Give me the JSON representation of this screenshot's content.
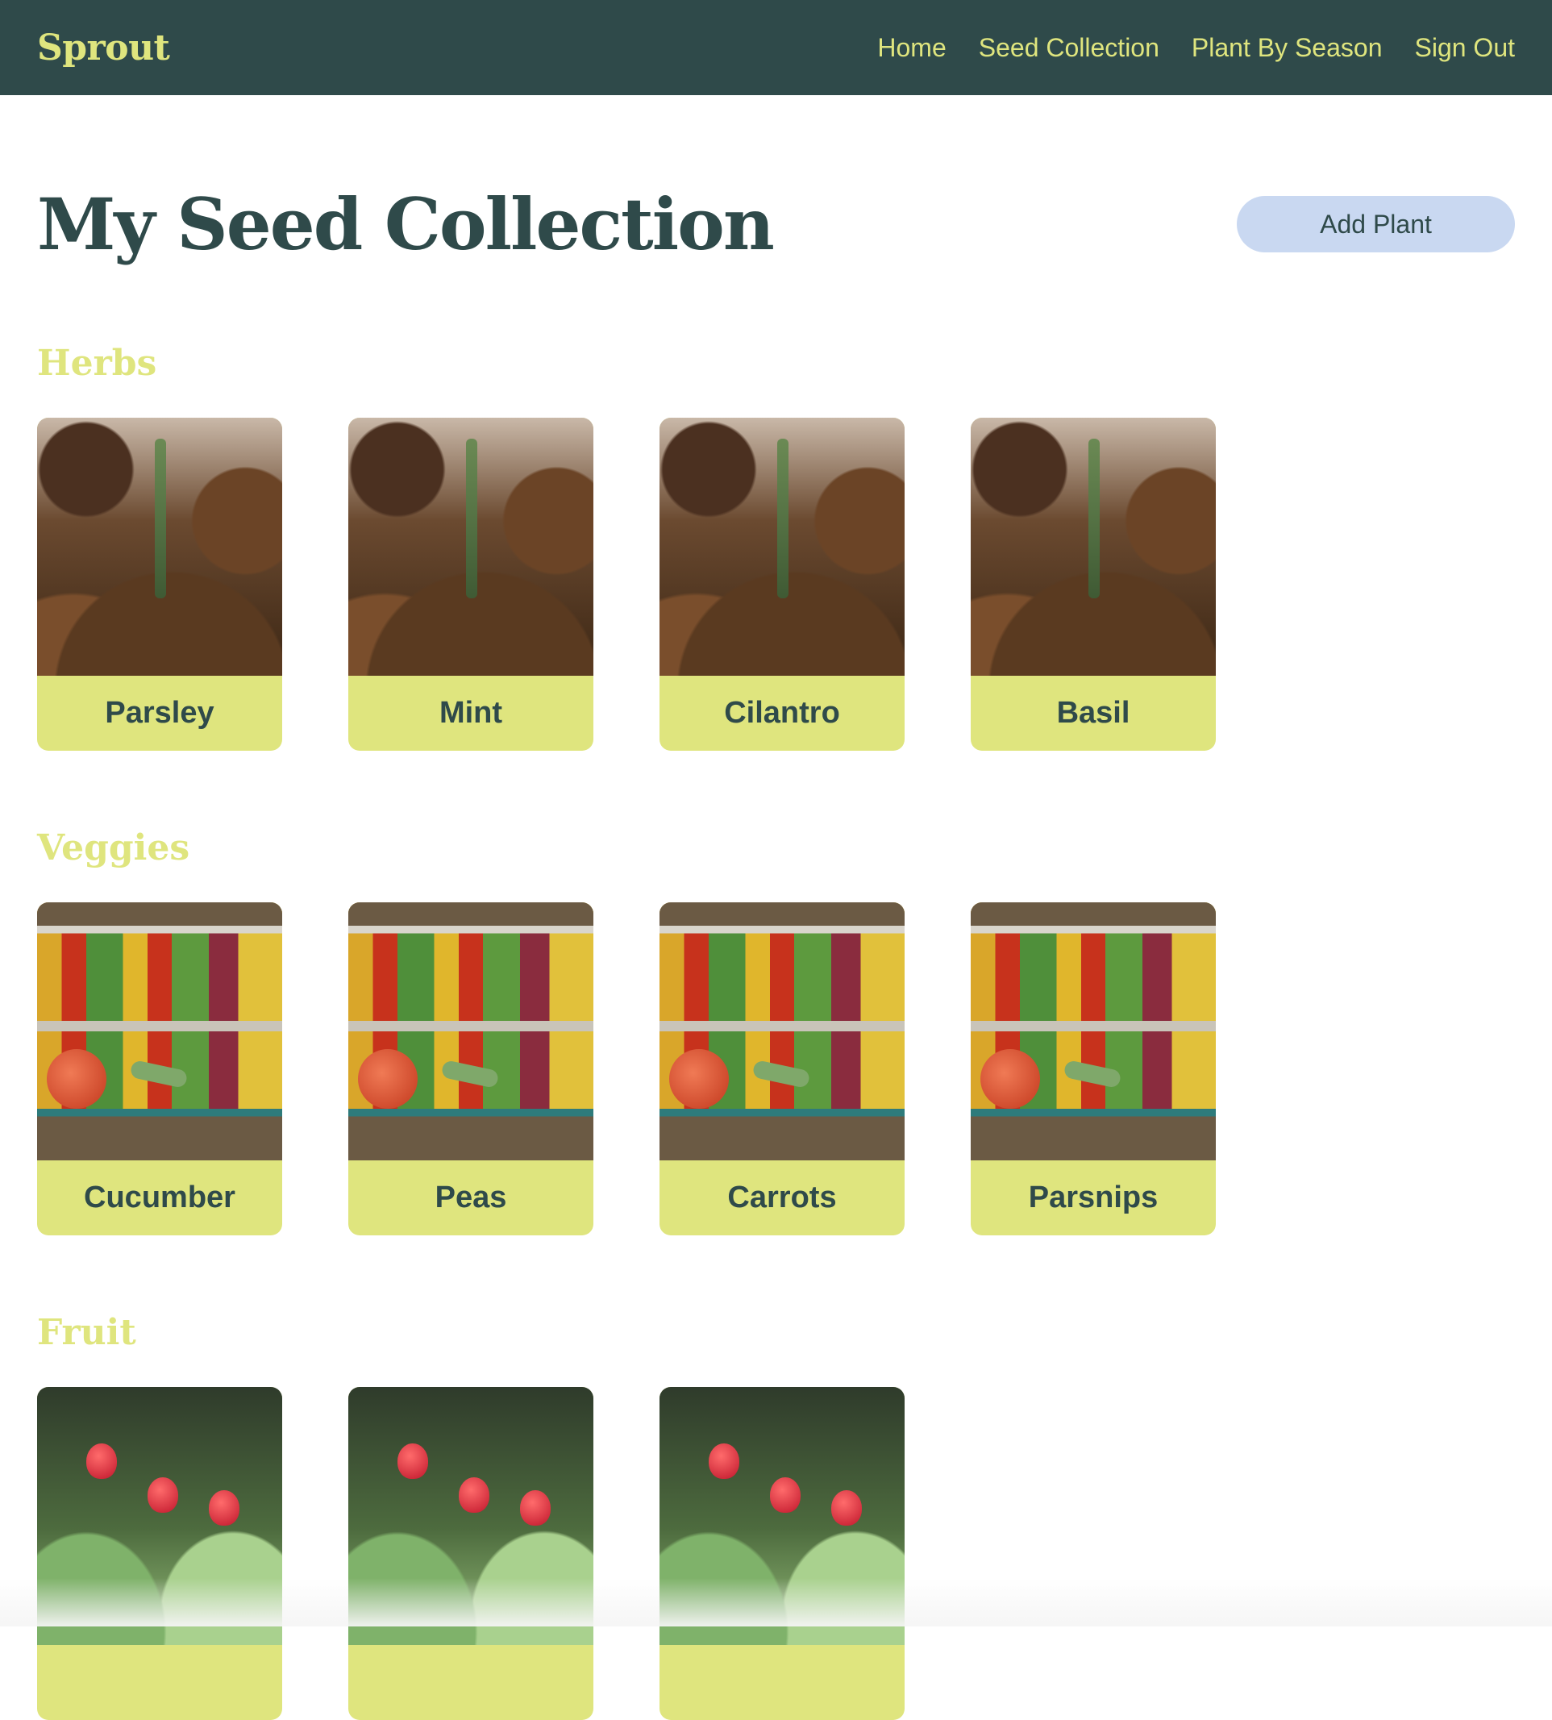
{
  "brand": "Sprout",
  "nav": {
    "home": "Home",
    "seed_collection": "Seed Collection",
    "plant_by_season": "Plant By Season",
    "sign_out": "Sign Out"
  },
  "page": {
    "title": "My Seed Collection",
    "add_button": "Add Plant"
  },
  "sections": {
    "herbs": {
      "title": "Herbs",
      "items": [
        "Parsley",
        "Mint",
        "Cilantro",
        "Basil"
      ]
    },
    "veggies": {
      "title": "Veggies",
      "items": [
        "Cucumber",
        "Peas",
        "Carrots",
        "Parsnips"
      ]
    },
    "fruit": {
      "title": "Fruit",
      "items": [
        "",
        "",
        ""
      ]
    }
  },
  "colors": {
    "topbar": "#2f4a4a",
    "accent": "#dfe57e",
    "button": "#c9d8f1"
  }
}
